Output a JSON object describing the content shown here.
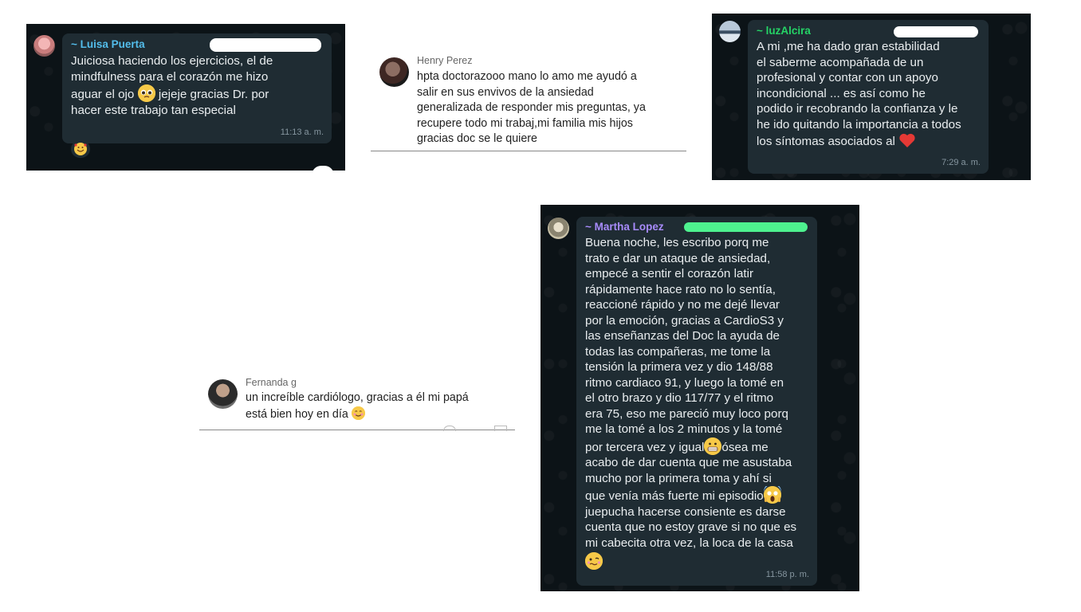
{
  "chats": {
    "luisa": {
      "sender": "~ Luisa Puerta",
      "message": "Juiciosa haciendo los ejercicios, el de\nmindfulness para el corazón me hizo\naguar el ojo",
      "message_end": " jejeje gracias Dr. por\nhacer este trabajo tan especial",
      "time": "11:13 a. m.",
      "sender_color": "#53bdeb"
    },
    "henry": {
      "sender": "Henry Perez",
      "message": "hpta doctorazooo mano lo amo me ayudó a\nsalir en sus envivos de la ansiedad\ngeneralizada de responder mis preguntas, ya\nrecupere todo mi trabaj,mi familia mis hijos\ngracias doc se le quiere"
    },
    "luz": {
      "sender": "~ luzAlcira",
      "message": "A mi ,me ha dado gran estabilidad\nel saberme acompañada de un\nprofesional y contar con un apoyo\nincondicional ... es así como he\npodido ir recobrando la confianza y le\nhe ido quitando la importancia a todos\nlos síntomas asociados al",
      "time": "7:29 a. m.",
      "sender_color": "#25d366"
    },
    "fernanda": {
      "sender": "Fernanda g",
      "message": "un increíble cardiólogo, gracias a él mi papá\nestá bien hoy en día"
    },
    "martha": {
      "sender": "~ Martha Lopez",
      "message": "Buena noche, les escribo porq me\ntrato e dar un ataque de ansiedad,\nempecé a sentir el corazón latir\nrápidamente hace rato no lo sentía,\nreaccioné rápido y no me dejé llevar\npor la emoción, gracias a CardioS3 y\nlas enseñanzas del Doc la ayuda de\ntodas las compañeras, me tome la\ntensión la primera vez y dio 148/88\nritmo cardiaco 91, y luego la tomé en\nel otro brazo y dio 117/77 y el ritmo\nera 75, eso me pareció muy loco porq\nme la tomé a los 2 minutos y la tomé\npor tercera vez y igual",
      "message_2": "ósea me\nacabo de dar cuenta que me asustaba\nmucho por la primera toma y ahí si\nque venía más fuerte mi episodio",
      "message_3": "juepucha hacerse consiente es darse\ncuenta que no estoy grave si no que es\nmi cabecita otra vez, la loca de la casa",
      "time": "11:58 p. m.",
      "sender_color": "#a78bfa"
    }
  },
  "emoji_names": [
    "pleading-face-emoji",
    "smiling-face-with-hearts-emoji",
    "red-heart-emoji",
    "smiling-face-emoji",
    "grimacing-face-emoji",
    "screaming-face-emoji",
    "woozy-face-emoji"
  ]
}
